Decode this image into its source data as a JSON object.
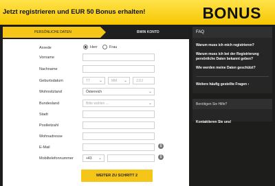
{
  "banner": {
    "headline": "Jetzt registrieren und EUR 50 Bonus erhalten!",
    "bonus": "BONUS"
  },
  "steps": [
    {
      "label": "Persönliche Daten"
    },
    {
      "label": "BWIN KONTO"
    }
  ],
  "form": {
    "anrede": {
      "label": "Anrede",
      "options": [
        "Herr",
        "Frau"
      ],
      "selected": "Herr"
    },
    "vorname": {
      "label": "Vorname",
      "value": ""
    },
    "nachname": {
      "label": "Nachname",
      "value": ""
    },
    "geburtsdatum": {
      "label": "Geburtsdatum",
      "day_placeholder": "TT",
      "month_placeholder": "MM",
      "year_placeholder": "JJJJ"
    },
    "wohnsitzland": {
      "label": "Wohnsitzland",
      "value": "Österreich"
    },
    "bundesland": {
      "label": "Bundesland",
      "placeholder": "Bitte wählen ..."
    },
    "stadt": {
      "label": "Stadt",
      "value": ""
    },
    "postleitzahl": {
      "label": "Postleitzahl",
      "value": ""
    },
    "wohnadresse": {
      "label": "Wohnadresse",
      "value": ""
    },
    "email": {
      "label": "E-Mail",
      "value": ""
    },
    "mobil": {
      "label": "Mobiltelefonnummer",
      "prefix": "+43",
      "value": ""
    },
    "submit": "Weiter zu Schritt 2"
  },
  "sidebar": {
    "faq_title": "FAQ",
    "questions": [
      "Warum muss ich mich registrieren?",
      "Warum muss ich bei der Registrierung persönliche Daten bekannt geben?",
      "Wie werden meine Daten geschützt?"
    ],
    "more_link": "Weitere häufig gestellte Fragen",
    "help_title": "Benötigen Sie Hilfe?",
    "contact_link": "Kontaktieren Sie uns!"
  },
  "colors": {
    "accent": "#f5c518",
    "background": "#1d1d1b"
  }
}
